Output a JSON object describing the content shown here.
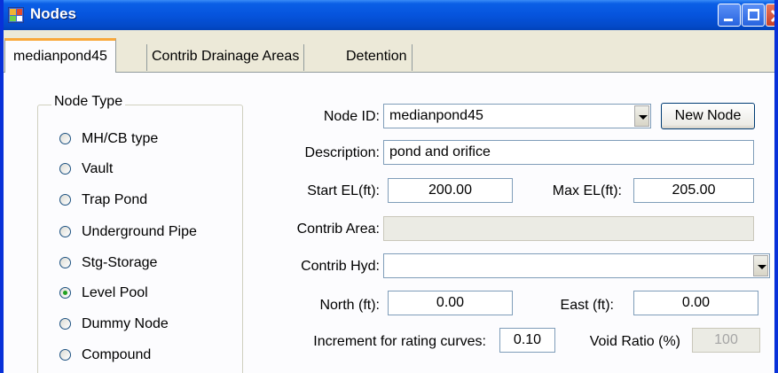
{
  "window": {
    "title": "Nodes",
    "accent_color": "#0054e3",
    "close_color": "#c8402a",
    "app_icon": "app-grid-icon"
  },
  "tabs": [
    {
      "label": "medianpond45",
      "selected": true
    },
    {
      "label": "Contrib Drainage Areas",
      "selected": false
    },
    {
      "label": "Detention",
      "selected": false
    }
  ],
  "node_type": {
    "legend": "Node Type",
    "options": [
      {
        "label": "MH/CB type",
        "checked": false
      },
      {
        "label": "Vault",
        "checked": false
      },
      {
        "label": "Trap Pond",
        "checked": false
      },
      {
        "label": "Underground Pipe",
        "checked": false
      },
      {
        "label": "Stg-Storage",
        "checked": false
      },
      {
        "label": "Level Pool",
        "checked": true
      },
      {
        "label": "Dummy Node",
        "checked": false
      },
      {
        "label": "Compound",
        "checked": false
      }
    ]
  },
  "form": {
    "node_id_label": "Node ID:",
    "node_id_value": "medianpond45",
    "new_node_label": "New Node",
    "description_label": "Description:",
    "description_value": "pond and orifice",
    "start_el_label": "Start EL(ft):",
    "start_el_value": "200.00",
    "max_el_label": "Max EL(ft):",
    "max_el_value": "205.00",
    "contrib_area_label": "Contrib Area:",
    "contrib_area_value": "",
    "contrib_hyd_label": "Contrib Hyd:",
    "contrib_hyd_value": "",
    "north_label": "North (ft):",
    "north_value": "0.00",
    "east_label": "East (ft):",
    "east_value": "0.00",
    "increment_label": "Increment for rating curves:",
    "increment_value": "0.10",
    "void_ratio_label": "Void Ratio (%)",
    "void_ratio_value": "100"
  }
}
